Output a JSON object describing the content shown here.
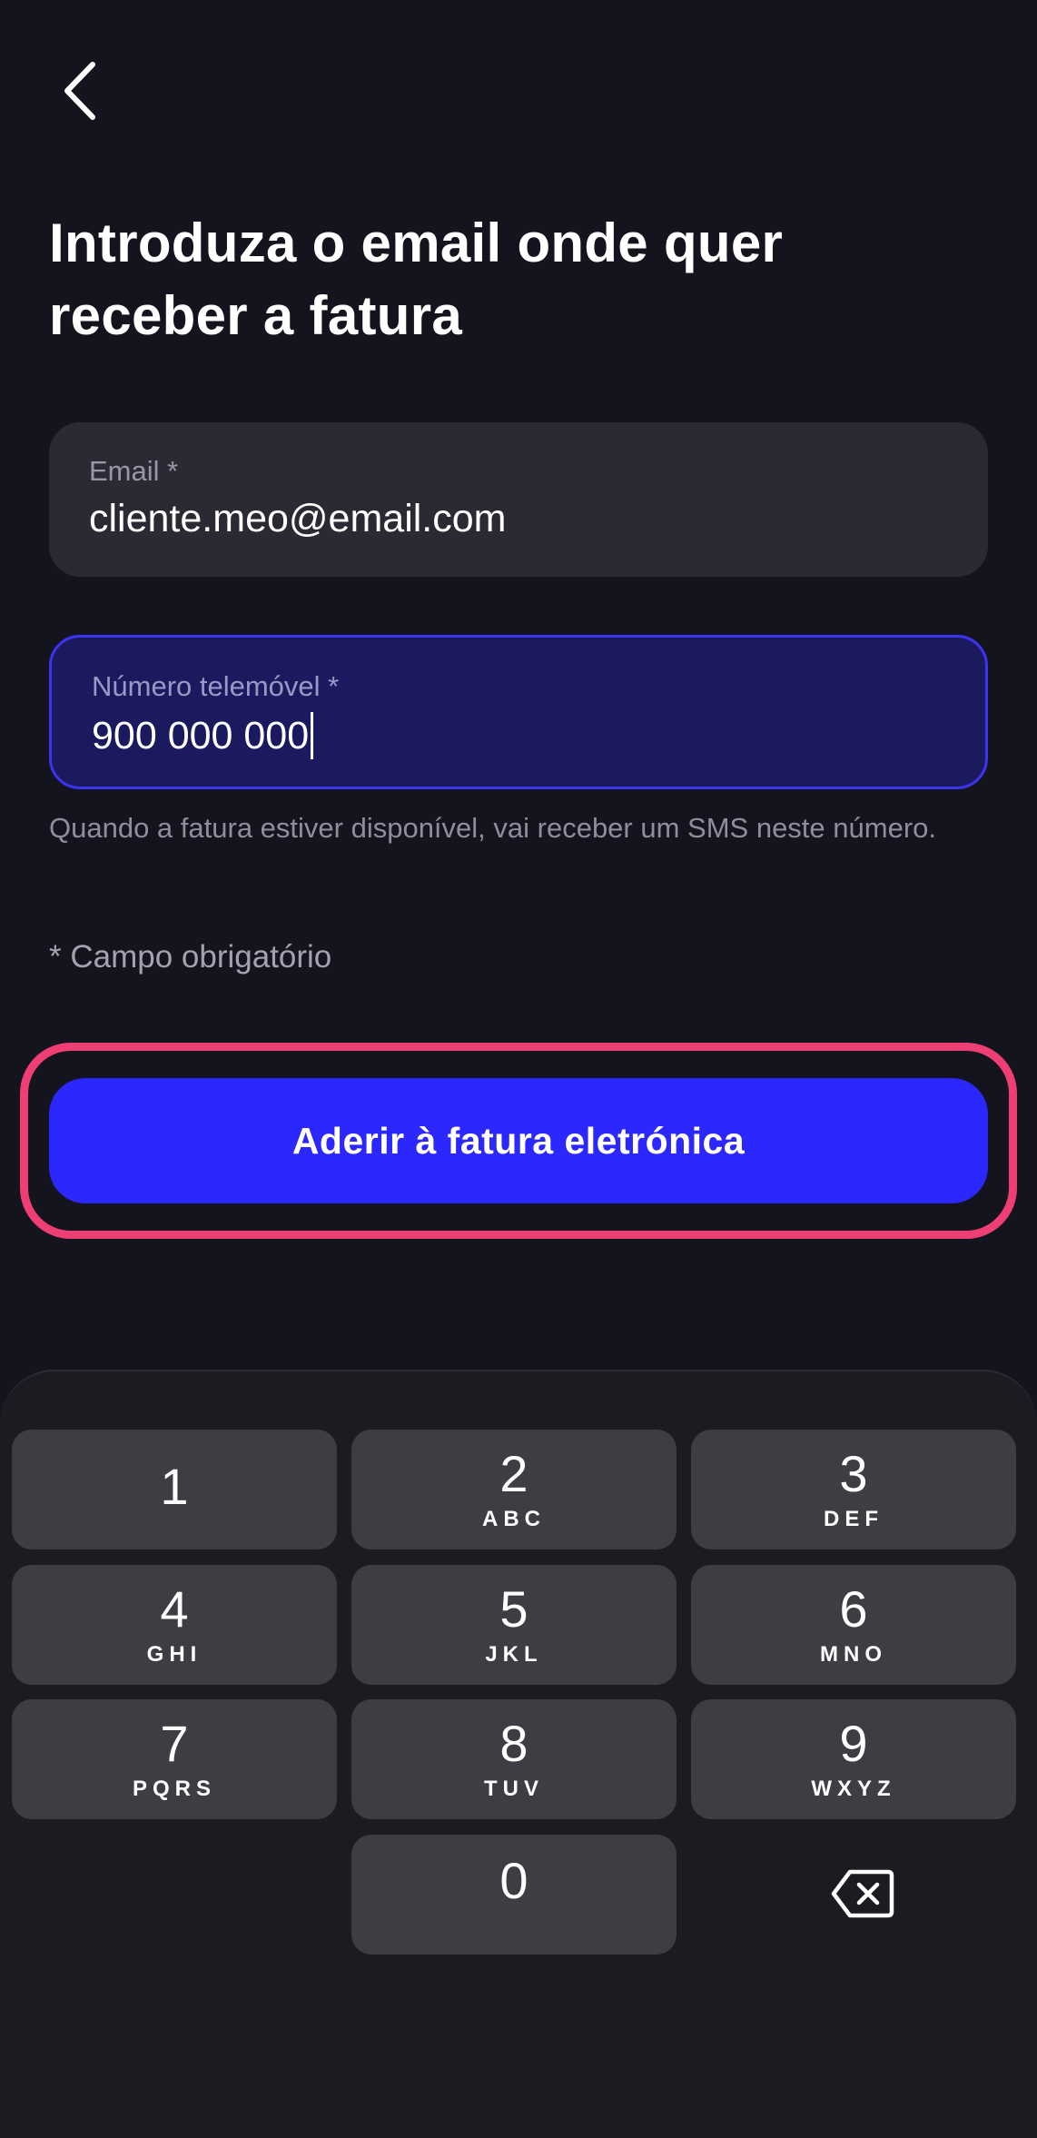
{
  "header": {
    "back_icon": "chevron-left-icon",
    "title": "Introduza o email onde quer receber a fatura"
  },
  "form": {
    "email": {
      "label": "Email *",
      "value": "cliente.meo@email.com"
    },
    "phone": {
      "label": "Número telemóvel *",
      "value": "900 000 000"
    },
    "hint": "Quando a fatura estiver disponível, vai receber um SMS neste número.",
    "required_note": "* Campo obrigatório"
  },
  "actions": {
    "submit_label": "Aderir à fatura eletrónica"
  },
  "keypad": {
    "keys": [
      {
        "digit": "1",
        "letters": ""
      },
      {
        "digit": "2",
        "letters": "ABC"
      },
      {
        "digit": "3",
        "letters": "DEF"
      },
      {
        "digit": "4",
        "letters": "GHI"
      },
      {
        "digit": "5",
        "letters": "JKL"
      },
      {
        "digit": "6",
        "letters": "MNO"
      },
      {
        "digit": "7",
        "letters": "PQRS"
      },
      {
        "digit": "8",
        "letters": "TUV"
      },
      {
        "digit": "9",
        "letters": "WXYZ"
      },
      {
        "digit": "0",
        "letters": ""
      }
    ],
    "backspace_icon": "backspace-icon"
  },
  "colors": {
    "background": "#14141f",
    "accent": "#2c27fc",
    "highlight": "#ee3f74",
    "field_focus": "#1c1a5e"
  }
}
